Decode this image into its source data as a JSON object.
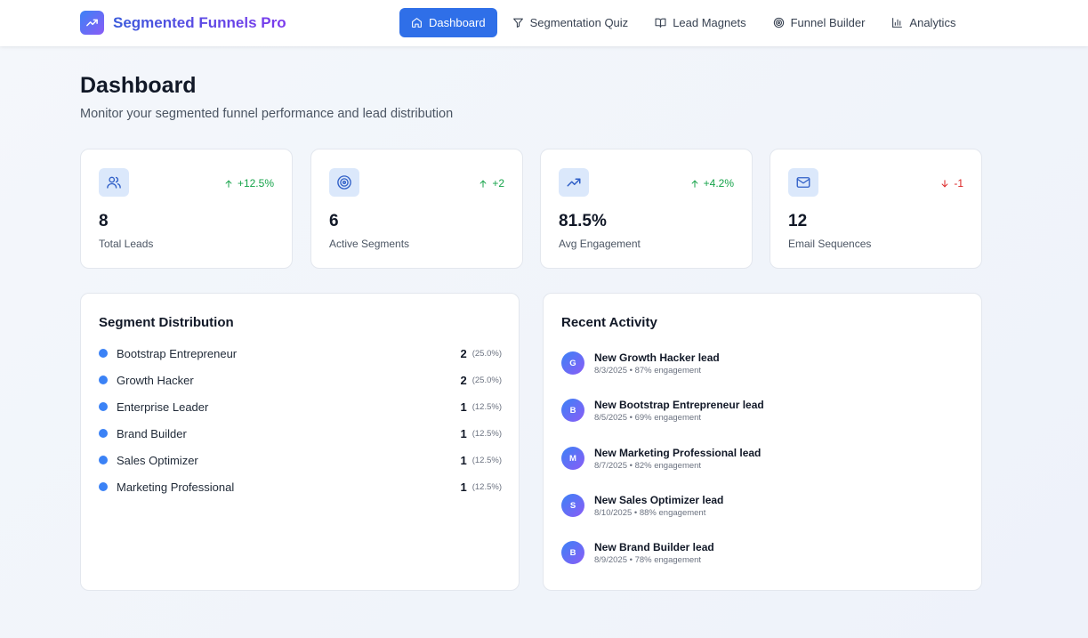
{
  "app": {
    "title": "Segmented Funnels Pro",
    "brand_gradient": [
      "#3b82f6",
      "#8b5cf6"
    ],
    "accent": "#2f6fe8"
  },
  "nav": [
    {
      "label": "Dashboard",
      "icon": "home-icon",
      "active": true
    },
    {
      "label": "Segmentation Quiz",
      "icon": "filter-icon",
      "active": false
    },
    {
      "label": "Lead Magnets",
      "icon": "book-icon",
      "active": false
    },
    {
      "label": "Funnel Builder",
      "icon": "target-icon",
      "active": false
    },
    {
      "label": "Analytics",
      "icon": "bar-chart-icon",
      "active": false
    }
  ],
  "page": {
    "title": "Dashboard",
    "subtitle": "Monitor your segmented funnel performance and lead distribution"
  },
  "stats": [
    {
      "icon": "users-icon",
      "change": "+12.5%",
      "direction": "up",
      "value": "8",
      "label": "Total Leads"
    },
    {
      "icon": "target-icon",
      "change": "+2",
      "direction": "up",
      "value": "6",
      "label": "Active Segments"
    },
    {
      "icon": "trending-up-icon",
      "change": "+4.2%",
      "direction": "up",
      "value": "81.5%",
      "label": "Avg Engagement"
    },
    {
      "icon": "mail-icon",
      "change": "-1",
      "direction": "down",
      "value": "12",
      "label": "Email Sequences"
    }
  ],
  "segments": {
    "title": "Segment Distribution",
    "items": [
      {
        "name": "Bootstrap Entrepreneur",
        "count": "2",
        "pct": "(25.0%)"
      },
      {
        "name": "Growth Hacker",
        "count": "2",
        "pct": "(25.0%)"
      },
      {
        "name": "Enterprise Leader",
        "count": "1",
        "pct": "(12.5%)"
      },
      {
        "name": "Brand Builder",
        "count": "1",
        "pct": "(12.5%)"
      },
      {
        "name": "Sales Optimizer",
        "count": "1",
        "pct": "(12.5%)"
      },
      {
        "name": "Marketing Professional",
        "count": "1",
        "pct": "(12.5%)"
      }
    ]
  },
  "activity": {
    "title": "Recent Activity",
    "items": [
      {
        "initial": "G",
        "title": "New Growth Hacker lead",
        "meta": "8/3/2025 • 87% engagement"
      },
      {
        "initial": "B",
        "title": "New Bootstrap Entrepreneur lead",
        "meta": "8/5/2025 • 69% engagement"
      },
      {
        "initial": "M",
        "title": "New Marketing Professional lead",
        "meta": "8/7/2025 • 82% engagement"
      },
      {
        "initial": "S",
        "title": "New Sales Optimizer lead",
        "meta": "8/10/2025 • 88% engagement"
      },
      {
        "initial": "B",
        "title": "New Brand Builder lead",
        "meta": "8/9/2025 • 78% engagement"
      }
    ]
  }
}
